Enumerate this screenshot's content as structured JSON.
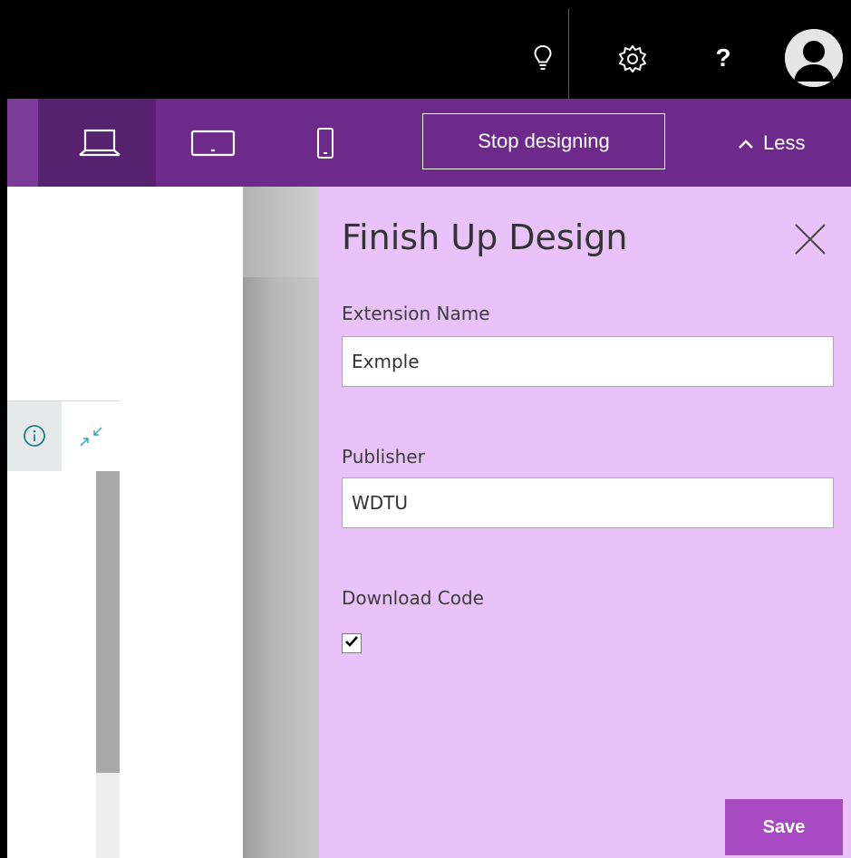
{
  "topbar": {
    "icons": [
      "lightbulb-icon",
      "gear-icon",
      "help-icon",
      "avatar-icon"
    ],
    "help_label": "?"
  },
  "device_bar": {
    "devices": [
      "laptop-icon",
      "tablet-icon",
      "phone-icon"
    ],
    "selected_device": "laptop",
    "stop_designing_label": "Stop designing",
    "less_label": "Less"
  },
  "panel": {
    "title": "Finish Up Design",
    "extension_name_label": "Extension Name",
    "extension_name_value": "Exmple",
    "publisher_label": "Publisher",
    "publisher_value": "WDTU",
    "download_code_label": "Download Code",
    "download_code_checked": true,
    "save_label": "Save"
  },
  "colors": {
    "topbar": "#000000",
    "device_bar": "#6e2a8b",
    "device_selected": "#56216f",
    "panel_bg": "#e8c2f8",
    "save_button": "#a84bc2",
    "accent_icon": "#1e7e8c"
  }
}
